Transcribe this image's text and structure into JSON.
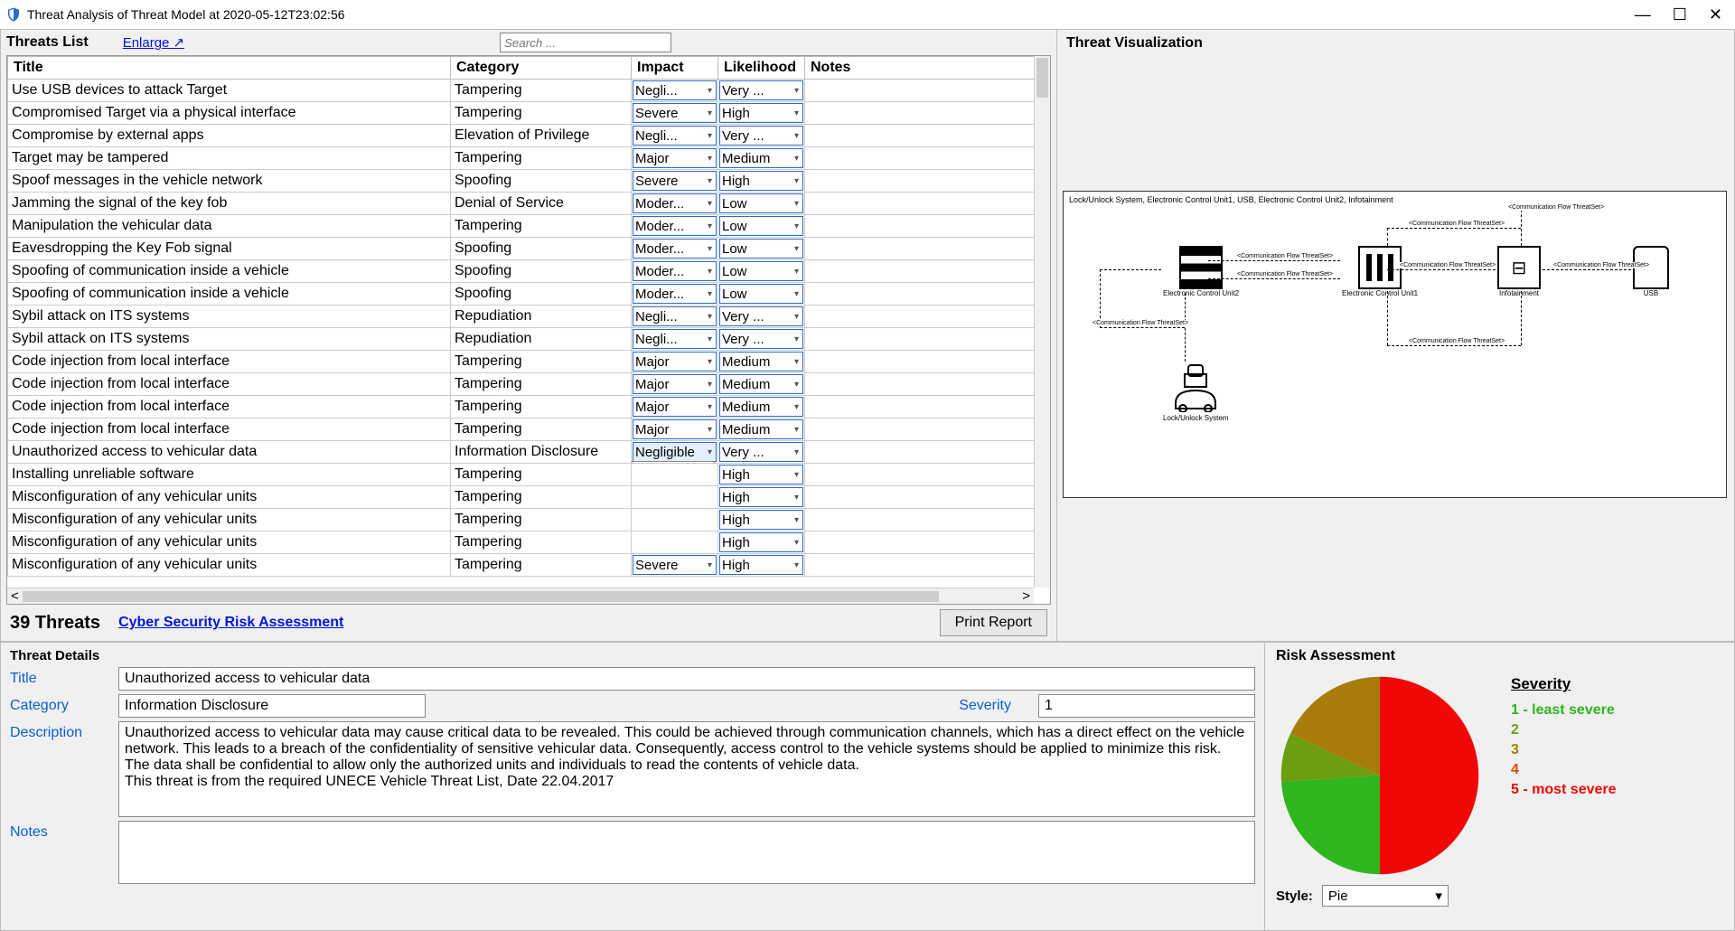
{
  "window": {
    "title": "Threat Analysis of Threat Model at 2020-05-12T23:02:56",
    "controls": {
      "min": "—",
      "max": "☐",
      "close": "✕"
    }
  },
  "threats_list": {
    "header_label": "Threats List",
    "enlarge": "Enlarge ↗",
    "search_placeholder": "Search ...",
    "columns": {
      "title": "Title",
      "category": "Category",
      "impact": "Impact",
      "likelihood": "Likelihood",
      "notes": "Notes"
    },
    "rows": [
      {
        "title": "Use USB devices to attack Target",
        "category": "Tampering",
        "impact": "Negli...",
        "likelihood": "Very ..."
      },
      {
        "title": "Compromised  Target via a physical interface",
        "category": "Tampering",
        "impact": "Severe",
        "likelihood": "High"
      },
      {
        "title": "Compromise by external apps",
        "category": "Elevation of Privilege",
        "impact": "Negli...",
        "likelihood": "Very ..."
      },
      {
        "title": "Target may be tampered",
        "category": "Tampering",
        "impact": "Major",
        "likelihood": "Medium"
      },
      {
        "title": "Spoof messages in the vehicle network",
        "category": "Spoofing",
        "impact": "Severe",
        "likelihood": "High"
      },
      {
        "title": "Jamming the signal of the key fob",
        "category": "Denial of Service",
        "impact": "Moder...",
        "likelihood": "Low"
      },
      {
        "title": "Manipulation the vehicular data",
        "category": "Tampering",
        "impact": "Moder...",
        "likelihood": "Low"
      },
      {
        "title": "Eavesdropping the Key Fob signal",
        "category": "Spoofing",
        "impact": "Moder...",
        "likelihood": "Low"
      },
      {
        "title": "Spoofing of communication inside a vehicle",
        "category": "Spoofing",
        "impact": "Moder...",
        "likelihood": "Low"
      },
      {
        "title": "Spoofing of communication inside a vehicle",
        "category": "Spoofing",
        "impact": "Moder...",
        "likelihood": "Low"
      },
      {
        "title": "Sybil attack on ITS systems",
        "category": "Repudiation",
        "impact": "Negli...",
        "likelihood": "Very ..."
      },
      {
        "title": "Sybil attack on ITS systems",
        "category": "Repudiation",
        "impact": "Negli...",
        "likelihood": "Very ..."
      },
      {
        "title": "Code injection from local interface",
        "category": "Tampering",
        "impact": "Major",
        "likelihood": "Medium"
      },
      {
        "title": "Code injection from local interface",
        "category": "Tampering",
        "impact": "Major",
        "likelihood": "Medium"
      },
      {
        "title": "Code injection from local interface",
        "category": "Tampering",
        "impact": "Major",
        "likelihood": "Medium"
      },
      {
        "title": "Code injection from local interface",
        "category": "Tampering",
        "impact": "Major",
        "likelihood": "Medium"
      },
      {
        "title": "Unauthorized access to vehicular data",
        "category": "Information Disclosure",
        "impact": "Negligible",
        "likelihood": "Very ..."
      },
      {
        "title": "Installing unreliable software",
        "category": "Tampering",
        "impact": "",
        "likelihood": "High"
      },
      {
        "title": "Misconfiguration of any vehicular units",
        "category": "Tampering",
        "impact": "",
        "likelihood": "High"
      },
      {
        "title": "Misconfiguration of any vehicular units",
        "category": "Tampering",
        "impact": "",
        "likelihood": "High"
      },
      {
        "title": "Misconfiguration of any vehicular units",
        "category": "Tampering",
        "impact": "",
        "likelihood": "High"
      },
      {
        "title": "Misconfiguration of any vehicular units",
        "category": "Tampering",
        "impact": "Severe",
        "likelihood": "High"
      }
    ],
    "impact_options": [
      "Severe",
      "Major",
      "Moderate",
      "Negligible"
    ],
    "open_dropdown_row": 16
  },
  "summary": {
    "count": "39 Threats",
    "link": "Cyber Security Risk Assessment",
    "print": "Print Report"
  },
  "visualization": {
    "header": "Threat Visualization",
    "caption": "Lock/Unlock System, Electronic Control Unit1, USB, Electronic Control Unit2, Infotainment",
    "nodes": {
      "ecu2": "Electronic Control Unit2",
      "ecu1": "Electronic Control Unit1",
      "infotainment": "Infotainment",
      "usb": "USB",
      "lock": "Lock/Unlock System"
    },
    "flow_label": "<Communication Flow ThreatSet>"
  },
  "details": {
    "header": "Threat Details",
    "labels": {
      "title": "Title",
      "category": "Category",
      "severity": "Severity",
      "description": "Description",
      "notes": "Notes"
    },
    "title": "Unauthorized access to vehicular data",
    "category": "Information Disclosure",
    "severity": "1",
    "description": "Unauthorized access to vehicular data may cause critical data to be revealed. This could be achieved through communication channels, which has a direct effect on the vehicle network. This leads to a breach of the confidentiality of sensitive vehicular data. Consequently, access control to the vehicle systems should be applied to minimize this risk. The data shall be confidential to allow only the authorized units and individuals to read the contents of vehicle data.\nThis threat is from the required UNECE Vehicle Threat List, Date 22.04.2017",
    "notes": ""
  },
  "risk": {
    "header": "Risk Assessment",
    "legend_title": "Severity",
    "levels": [
      {
        "label": "1 - least severe",
        "color": "#2fb51d"
      },
      {
        "label": "2",
        "color": "#6d9d11"
      },
      {
        "label": "3",
        "color": "#a87c0a"
      },
      {
        "label": "4",
        "color": "#d94a0a"
      },
      {
        "label": "5 - most severe",
        "color": "#f20707"
      }
    ],
    "style_label": "Style:",
    "style_value": "Pie"
  },
  "chart_data": {
    "type": "pie",
    "title": "Risk Assessment",
    "series_name": "Severity",
    "slices": [
      {
        "label": "5 - most severe",
        "value": 50,
        "color": "#f20707"
      },
      {
        "label": "1 - least severe",
        "value": 24,
        "color": "#2fb51d"
      },
      {
        "label": "2",
        "value": 8,
        "color": "#6d9d11"
      },
      {
        "label": "3",
        "value": 18,
        "color": "#a87c0a"
      }
    ]
  }
}
